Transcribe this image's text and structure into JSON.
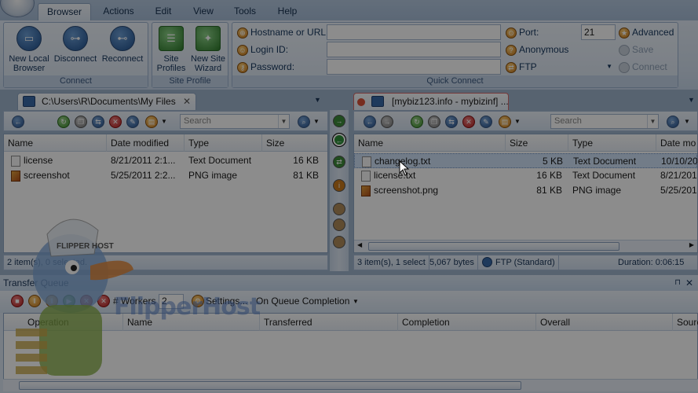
{
  "ribbon": {
    "tabs": [
      "Browser",
      "Actions",
      "Edit",
      "View",
      "Tools",
      "Help"
    ],
    "active_tab": "Browser",
    "connect_group": {
      "title": "Connect",
      "buttons": [
        "New Local Browser",
        "Disconnect",
        "Reconnect"
      ]
    },
    "site_profile_group": {
      "title": "Site Profile",
      "buttons": [
        "Site Profiles",
        "New Site Wizard"
      ]
    },
    "quick_connect": {
      "title": "Quick Connect",
      "hostname_label": "Hostname or URL:",
      "login_label": "Login ID:",
      "password_label": "Password:",
      "port_label": "Port:",
      "port_value": "21",
      "anonymous_label": "Anonymous",
      "protocol": "FTP",
      "advanced_label": "Advanced",
      "save_label": "Save",
      "connect_label": "Connect"
    }
  },
  "left_pane": {
    "tab_title": "C:\\Users\\R\\Documents\\My Files",
    "search_placeholder": "Search",
    "columns": [
      "Name",
      "Date modified",
      "Type",
      "Size"
    ],
    "rows": [
      {
        "name": "license",
        "date": "8/21/2011 2:1...",
        "type": "Text Document",
        "size": "16 KB",
        "icon": "text-file-icon"
      },
      {
        "name": "screenshot",
        "date": "5/25/2011 2:2...",
        "type": "PNG image",
        "size": "81 KB",
        "icon": "image-file-icon"
      }
    ],
    "status": "2 item(s), 0 selected."
  },
  "right_pane": {
    "tab_title": "[mybiz123.info - mybizinf] ...",
    "search_placeholder": "Search",
    "columns": [
      "Name",
      "Size",
      "Type",
      "Date mo"
    ],
    "rows": [
      {
        "name": "changelog.txt",
        "size": "5 KB",
        "type": "Text Document",
        "date": "10/10/20",
        "icon": "text-file-icon"
      },
      {
        "name": "license.txt",
        "size": "16 KB",
        "type": "Text Document",
        "date": "8/21/201",
        "icon": "text-file-icon"
      },
      {
        "name": "screenshot.png",
        "size": "81 KB",
        "type": "PNG image",
        "date": "5/25/201",
        "icon": "image-file-icon"
      }
    ],
    "status_items": "3 item(s), 1 select",
    "status_bytes": "5,067 bytes",
    "status_protocol": "FTP (Standard)",
    "status_duration": "Duration: 0:06:15"
  },
  "queue": {
    "title": "Transfer Queue",
    "workers_label": "# Workers",
    "workers_value": "2",
    "settings_label": "Settings...",
    "completion_label": "On Queue Completion",
    "columns": [
      "Operation",
      "Name",
      "Transferred",
      "Completion",
      "Overall",
      "Sourc"
    ]
  },
  "watermark": {
    "mascot_text": "FLIPPER HOST",
    "brand_text": "FlipperHost"
  }
}
